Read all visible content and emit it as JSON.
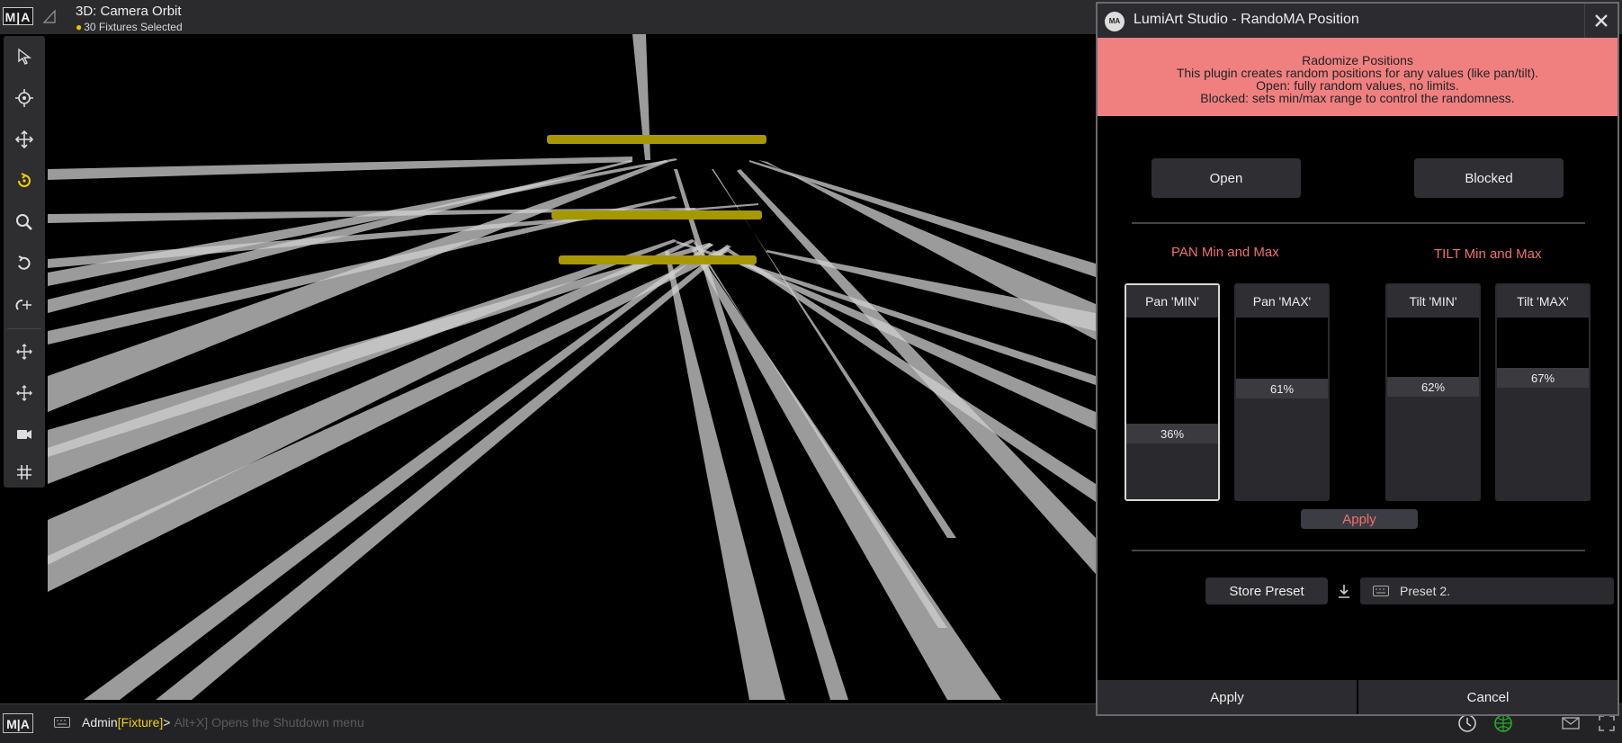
{
  "app": {
    "logo": "M|A",
    "view_title": "3D: Camera Orbit",
    "view_subtitle": "30 Fixtures Selected"
  },
  "toolbar": {
    "tools": [
      {
        "icon": "pointer-icon",
        "active": false
      },
      {
        "icon": "target-icon",
        "active": false
      },
      {
        "icon": "move-icon",
        "active": false
      },
      {
        "icon": "orbit-icon",
        "active": true
      },
      {
        "icon": "zoom-icon",
        "active": false
      },
      {
        "icon": "rotate-icon",
        "active": false
      },
      {
        "icon": "rotate-move-icon",
        "active": false
      },
      {
        "icon": "pan-icon",
        "active": false
      },
      {
        "icon": "move-alt-icon",
        "active": false
      },
      {
        "icon": "camera-icon",
        "active": false
      },
      {
        "icon": "grid-icon",
        "active": false
      }
    ],
    "accent": "#f2d100"
  },
  "command_line": {
    "logo": "M|A",
    "user": "Admin",
    "object": "[Fixture]",
    "prompt": ">",
    "hint": "Alt+X] Opens the Shutdown menu"
  },
  "dialog": {
    "title": "LumiArt Studio - RandoMA Position",
    "logo": "MA",
    "banner": {
      "heading": "Radomize Positions",
      "line1": "This plugin creates random positions for any values (like pan/tilt).",
      "line2": "Open: fully random values, no limits.",
      "line3": "Blocked: sets min/max range to control the randomness.",
      "color": "#f08080"
    },
    "mode_buttons": {
      "open": "Open",
      "blocked": "Blocked"
    },
    "pan_label": "PAN Min and Max",
    "tilt_label": "TILT Min and Max",
    "faders": [
      {
        "label": "Pan 'MIN'",
        "value": "36%",
        "level": 0.36,
        "active": true
      },
      {
        "label": "Pan 'MAX'",
        "value": "61%",
        "level": 0.61,
        "active": false
      },
      {
        "label": "Tilt 'MIN'",
        "value": "62%",
        "level": 0.62,
        "active": false
      },
      {
        "label": "Tilt 'MAX'",
        "value": "67%",
        "level": 0.67,
        "active": false
      }
    ],
    "apply_small": "Apply",
    "store_preset": "Store Preset",
    "preset_name": "Preset 2.",
    "footer": {
      "apply": "Apply",
      "cancel": "Cancel"
    },
    "label_color": "#f07070"
  }
}
